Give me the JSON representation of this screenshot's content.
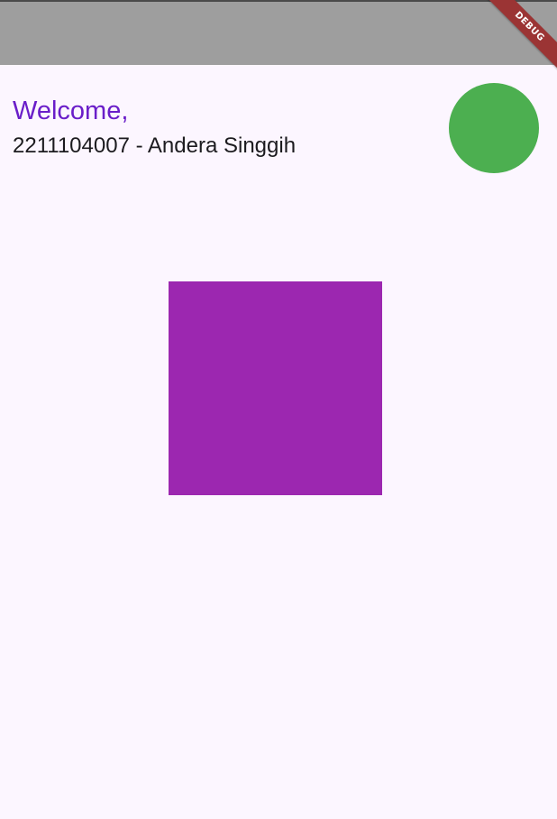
{
  "app_bar": {
    "debug_label": "DEBUG",
    "color": "#9e9e9e"
  },
  "header": {
    "welcome": "Welcome,",
    "user_line": "2211104007 - Andera Singgih",
    "welcome_color": "#6a1ec9"
  },
  "avatar": {
    "color": "#4caf50"
  },
  "box": {
    "color": "#9c27b0"
  }
}
